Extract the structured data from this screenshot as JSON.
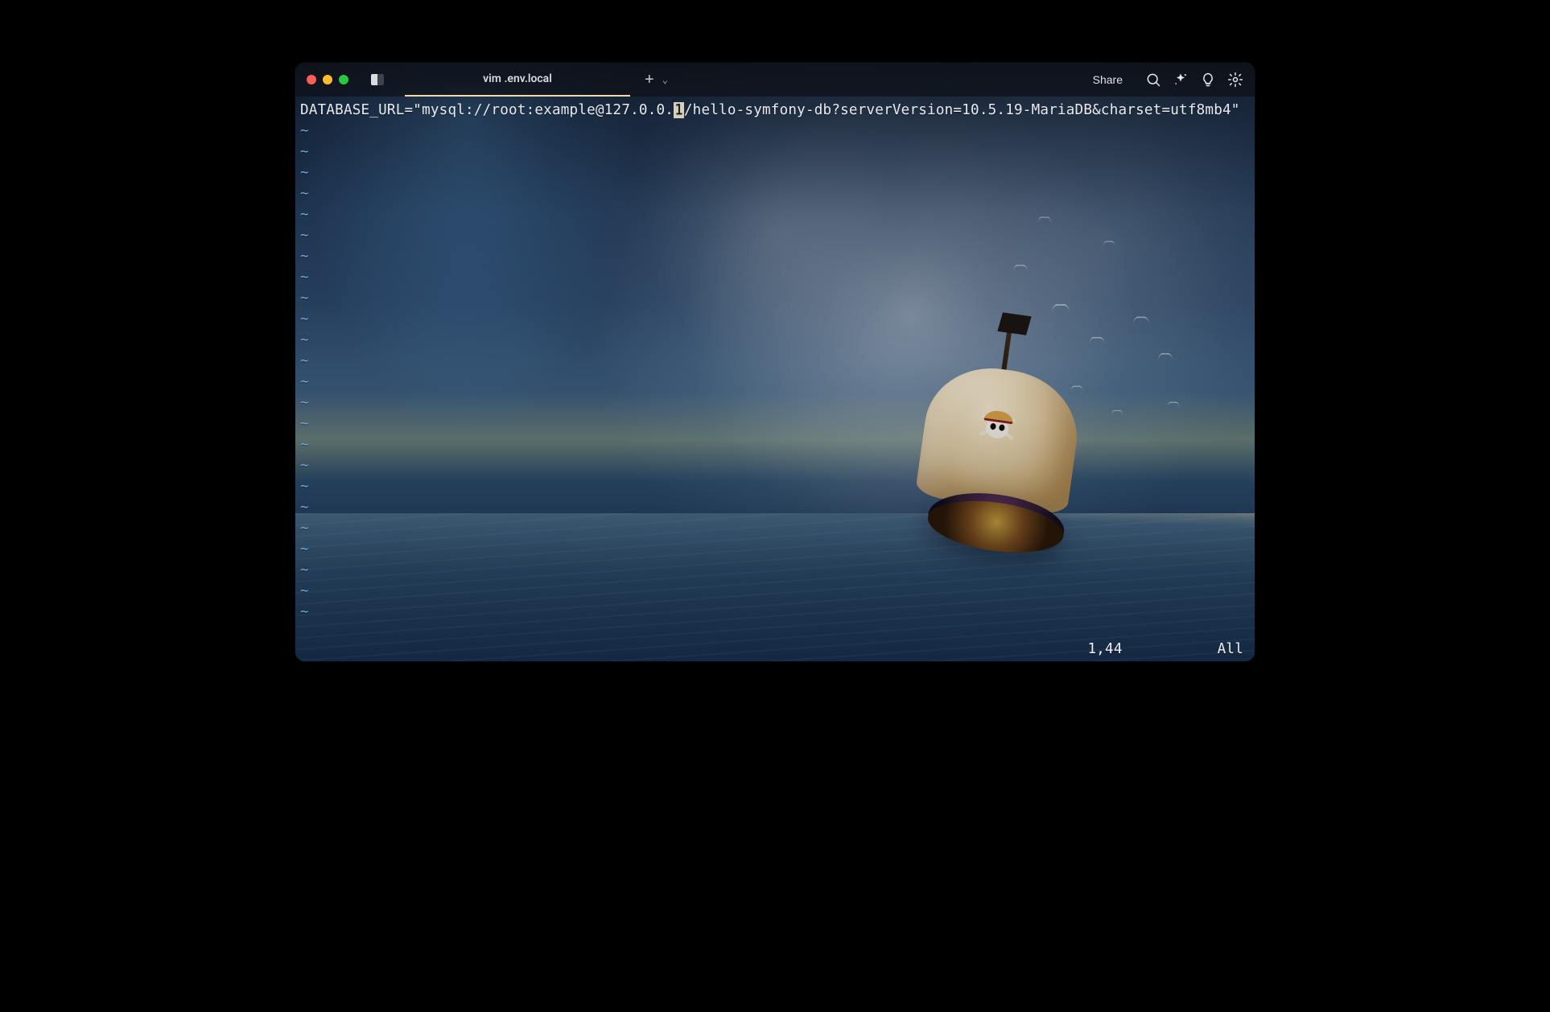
{
  "titlebar": {
    "tab_title": "vim .env.local",
    "share_label": "Share",
    "icons": {
      "panes": "panes-icon",
      "new_tab_plus": "+",
      "new_tab_chevron": "⌄",
      "search": "search-icon",
      "sparkle": "sparkle-icon",
      "bulb": "bulb-icon",
      "settings": "gear-icon"
    },
    "traffic": {
      "red": "#ff5f57",
      "yellow": "#febc2e",
      "green": "#28c840"
    }
  },
  "editor": {
    "content_before_cursor": "DATABASE_URL=\"mysql://root:example@127.0.0.",
    "cursor_char": "1",
    "content_after_cursor": "/hello-symfony-db?serverVersion=10.5.19-MariaDB&charset=utf8mb4\"",
    "empty_marker": "~",
    "empty_line_count": 24
  },
  "status": {
    "position": "1,44",
    "scope": "All"
  }
}
